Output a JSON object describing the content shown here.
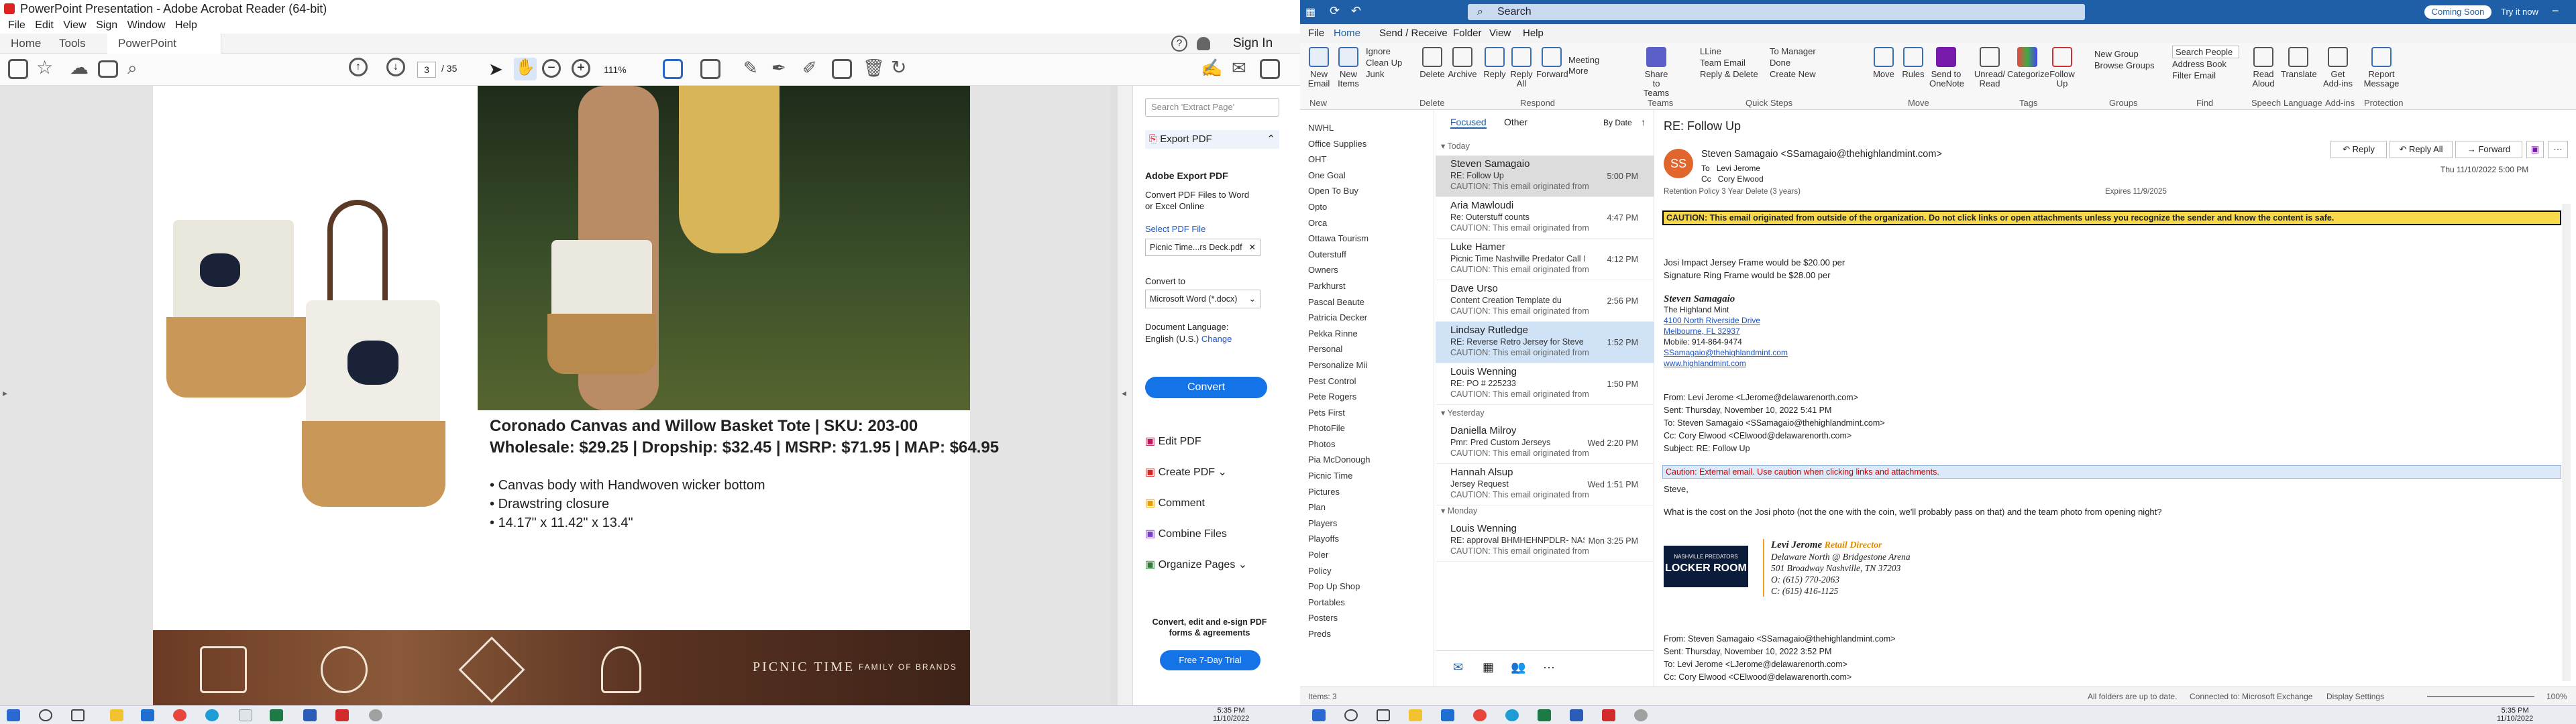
{
  "acrobat": {
    "title": "PowerPoint Presentation - Adobe Acrobat Reader (64-bit)",
    "menu": [
      "File",
      "Edit",
      "View",
      "Sign",
      "Window",
      "Help"
    ],
    "tabs": {
      "home": "Home",
      "tools": "Tools",
      "doc": "PowerPoint Present..."
    },
    "signin": "Sign In",
    "page_current": "3",
    "page_total": "/ 35",
    "zoom": "111%",
    "slide": {
      "heading": "Coronado Canvas and Willow Basket Tote | SKU: 203-00",
      "prices": "Wholesale: $29.25 | Dropship: $32.45 | MSRP: $71.95 | MAP: $64.95",
      "bullets": [
        "Canvas body with Handwoven wicker bottom",
        "Drawstring closure",
        "14.17\" x 11.42\" x 13.4\""
      ],
      "brand": "PICNIC TIME",
      "brand_sub": "FAMILY OF BRANDS"
    },
    "panel": {
      "search_placeholder": "Search 'Extract Page'",
      "export_title": "Export PDF",
      "adobe_export": "Adobe Export PDF",
      "convert_desc": "Convert PDF Files to Word or Excel Online",
      "select_pdf": "Select PDF File",
      "file_name": "Picnic Time...rs Deck.pdf",
      "convert_to": "Convert to",
      "format": "Microsoft Word (*.docx)",
      "doc_lang": "Document Language:",
      "lang": "English (U.S.)",
      "change": "Change",
      "convert_btn": "Convert",
      "tools": [
        "Edit PDF",
        "Create PDF",
        "Comment",
        "Combine Files",
        "Organize Pages"
      ],
      "promo": "Convert, edit and e-sign PDF forms & agreements",
      "trial_btn": "Free 7-Day Trial"
    }
  },
  "outlook": {
    "search_placeholder": "Search",
    "coming_soon": "Coming Soon",
    "try_it_now": "Try it now",
    "menu": [
      "File",
      "Home",
      "Send / Receive",
      "Folder",
      "View",
      "Help"
    ],
    "ribbon": {
      "new_email": "New Email",
      "new_items": "New Items",
      "ignore": "Ignore",
      "clean_up": "Clean Up",
      "junk": "Junk",
      "delete": "Delete",
      "archive": "Archive",
      "reply": "Reply",
      "reply_all": "Reply All",
      "forward": "Forward",
      "meeting": "Meeting",
      "more": "More",
      "share": "Share to Teams",
      "qs": [
        "LLine",
        "Team Email",
        "Reply & Delete",
        "To Manager",
        "Done",
        "Create New"
      ],
      "move": "Move",
      "rules": "Rules",
      "onenote": "Send to OneNote",
      "unread": "Unread/ Read",
      "categorize": "Categorize",
      "follow": "Follow Up",
      "new_group": "New Group",
      "browse_groups": "Browse Groups",
      "search_people": "Search People",
      "address_book": "Address Book",
      "filter_email": "Filter Email",
      "read_aloud": "Read Aloud",
      "translate": "Translate",
      "get_addins": "Get Add-ins",
      "report": "Report Message",
      "groups": [
        "New",
        "Delete",
        "Respond",
        "Teams",
        "Quick Steps",
        "Move",
        "Tags",
        "Groups",
        "Find",
        "Speech",
        "Language",
        "Add-ins",
        "Protection"
      ]
    },
    "folders": [
      "NWHL",
      "Office Supplies",
      "OHT",
      "One Goal",
      "Open To Buy",
      "Opto",
      "Orca",
      "Ottawa Tourism",
      "Outerstuff",
      "Owners",
      "Parkhurst",
      "Pascal Beaute",
      "Patricia Decker",
      "Pekka Rinne",
      "Personal",
      "Personalize Mii",
      "Pest Control",
      "Pete Rogers",
      "Pets First",
      "PhotoFile",
      "Photos",
      "Pia McDonough",
      "Picnic Time",
      "Pictures",
      "Plan",
      "Players",
      "Playoffs",
      "Poler",
      "Policy",
      "Pop Up Shop",
      "Portables",
      "Posters",
      "Preds"
    ],
    "list": {
      "focused": "Focused",
      "other": "Other",
      "sort": "By Date",
      "today": "Today",
      "yesterday": "Yesterday",
      "monday": "Monday",
      "items": [
        {
          "sender": "Steven Samagaio",
          "subject": "RE: Follow Up",
          "preview": "CAUTION: This email originated from",
          "time": "5:00 PM"
        },
        {
          "sender": "Aria Mawloudi",
          "subject": "Re: Outerstuff counts",
          "preview": "CAUTION: This email originated from",
          "time": "4:47 PM"
        },
        {
          "sender": "Luke Hamer",
          "subject": "Picnic Time Nashville Predator Call Fol...",
          "preview": "CAUTION: This email originated from",
          "time": "4:12 PM"
        },
        {
          "sender": "Dave Urso",
          "subject": "Content Creation Template du",
          "preview": "CAUTION: This email originated from",
          "time": "2:56 PM"
        },
        {
          "sender": "Lindsay Rutledge",
          "subject": "RE: Reverse Retro Jersey for Steve Sulli...",
          "preview": "CAUTION: This email originated from",
          "time": "1:52 PM"
        },
        {
          "sender": "Louis Wenning",
          "subject": "RE: PO # 225233",
          "preview": "CAUTION: This email originated from",
          "time": "1:50 PM"
        },
        {
          "sender": "Daniella Milroy",
          "subject": "Pmr: Pred Custom Jerseys",
          "preview": "CAUTION: This email originated from",
          "time": "Wed 2:20 PM"
        },
        {
          "sender": "Hannah Alsup",
          "subject": "Jersey Request",
          "preview": "CAUTION: This email originated from",
          "time": "Wed 1:51 PM"
        },
        {
          "sender": "Louis Wenning",
          "subject": "RE: approval BHMHEHNPDLR- NASHVI...",
          "preview": "CAUTION: This email originated from",
          "time": "Mon 3:25 PM"
        }
      ]
    },
    "read": {
      "subject": "RE: Follow Up",
      "initials": "SS",
      "from": "Steven Samagaio <SSamagaio@thehighlandmint.com>",
      "to_label": "To",
      "to": "Levi Jerome",
      "cc_label": "Cc",
      "cc": "Cory Elwood",
      "retention": "Retention Policy   3 Year Delete (3 years)",
      "expires": "Expires   11/9/2025",
      "reply": "Reply",
      "reply_all": "Reply All",
      "forward": "Forward",
      "date": "Thu 11/10/2022 5:00 PM",
      "caution_banner": "CAUTION: This email originated from outside of the organization. Do not click links or open attachments unless you recognize the sender and know the content is safe.",
      "line1": "Josi Impact Jersey Frame would be $20.00 per",
      "line2": "Signature Ring Frame would be $28.00 per",
      "sig_name": "Steven Samagaio",
      "sig_company": "The Highland Mint",
      "sig_addr1": "4100 North Riverside Drive",
      "sig_addr2": "Melbourne, FL 32937",
      "sig_mobile": "Mobile: 914-864-9474",
      "sig_email": "SSamagaio@thehighlandmint.com",
      "sig_web": "www.highlandmint.com",
      "q_from": "From: Levi Jerome <LJerome@delawarenorth.com>",
      "q_sent": "Sent: Thursday, November 10, 2022 5:41 PM",
      "q_to": "To: Steven Samagaio <SSamagaio@thehighlandmint.com>",
      "q_cc": "Cc: Cory Elwood <CElwood@delawarenorth.com>",
      "q_subject": "Subject: RE: Follow Up",
      "ext_caution": "Caution: External email. Use caution when clicking links and attachments.",
      "greet": "Steve,",
      "question": "What is the cost on the Josi photo (not the one with the coin, we'll probably pass on that) and the team photo from opening night?",
      "lj_name": "Levi Jerome",
      "lj_title": "Retail Director",
      "lj_l1": "Delaware North @ Bridgestone Arena",
      "lj_l2": "501 Broadway Nashville, TN 37203",
      "lj_l3": "O: (615) 770-2063",
      "lj_l4": "C: (615) 416-1125",
      "logo_top": "NASHVILLE PREDATORS",
      "logo_main": "LOCKER ROOM",
      "q2_from": "From: Steven Samagaio <SSamagaio@thehighlandmint.com>",
      "q2_sent": "Sent: Thursday, November 10, 2022 3:52 PM",
      "q2_to": "To: Levi Jerome <LJerome@delawarenorth.com>",
      "q2_cc": "Cc: Cory Elwood <CElwood@delawarenorth.com>"
    },
    "status": {
      "items": "Items: 3",
      "folders": "All folders are up to date.",
      "connected": "Connected to: Microsoft Exchange",
      "display": "Display Settings",
      "zoom": "100%"
    }
  },
  "taskbar": {
    "time_left": "5:35 PM",
    "date_left": "11/10/2022",
    "time_right": "5:35 PM",
    "date_right": "11/10/2022"
  }
}
